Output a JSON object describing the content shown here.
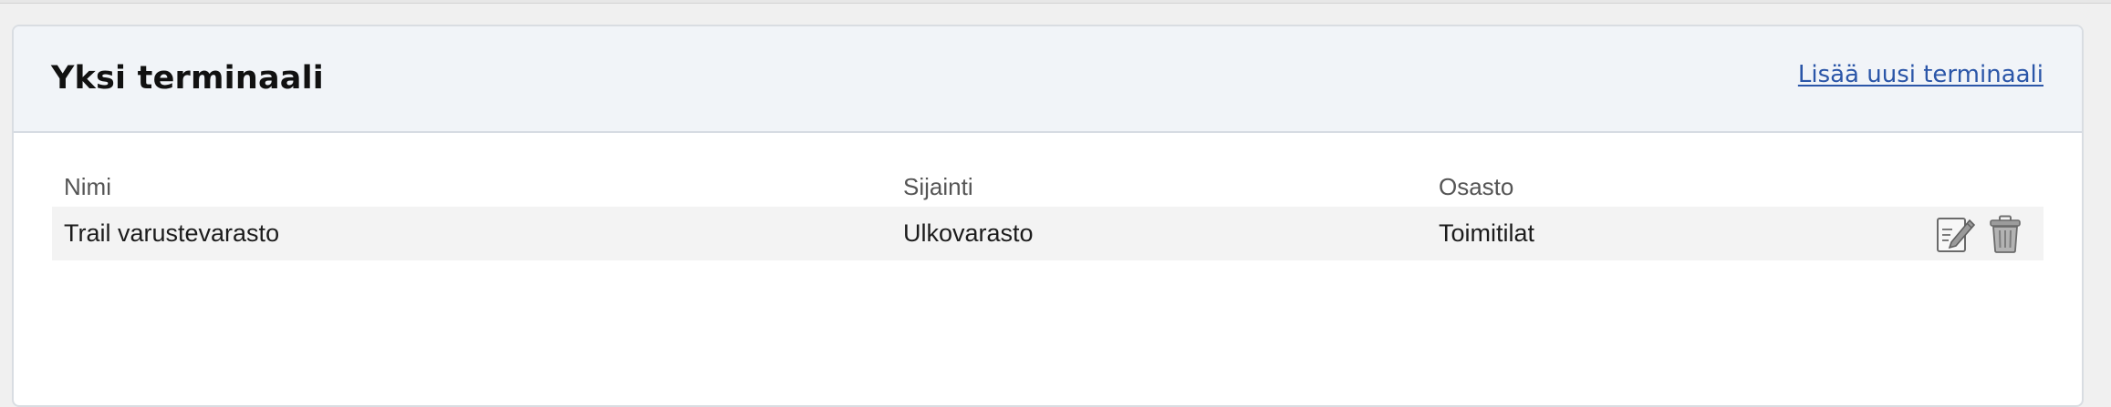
{
  "panel": {
    "title": "Yksi terminaali",
    "add_link_label": "Lisää uusi terminaali"
  },
  "table": {
    "columns": [
      "Nimi",
      "Sijainti",
      "Osasto"
    ],
    "rows": [
      {
        "nimi": "Trail varustevarasto",
        "sijainti": "Ulkovarasto",
        "osasto": "Toimitilat",
        "actions": [
          "edit-icon",
          "trash-icon"
        ]
      }
    ]
  },
  "colors": {
    "link": "#2b56a8",
    "header_background": "#f1f4f8",
    "row_background": "#f3f3f3"
  }
}
